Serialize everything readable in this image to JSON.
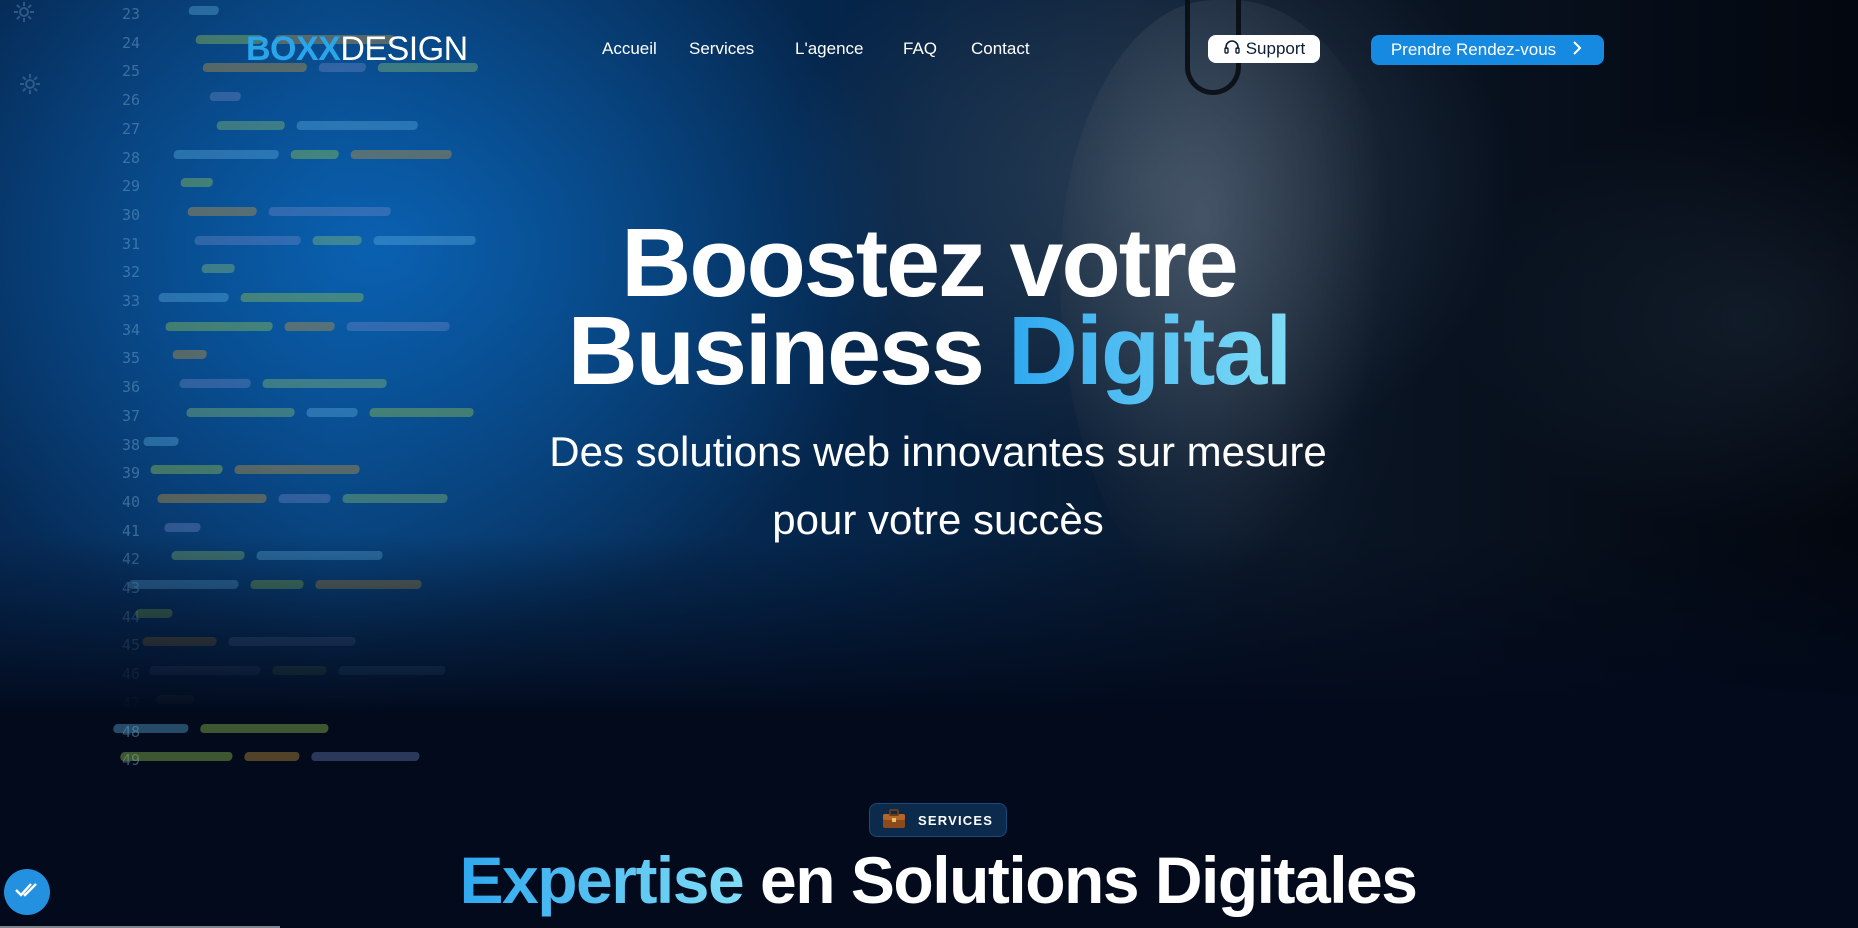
{
  "logo": {
    "prefix": "BO",
    "accent": "XX",
    "suffix": "DESIGN"
  },
  "nav": {
    "items": [
      "Accueil",
      "Services",
      "L'agence",
      "FAQ",
      "Contact"
    ]
  },
  "header": {
    "support_label": "Support",
    "cta_label": "Prendre Rendez-vous"
  },
  "hero": {
    "title_line1": "Boostez votre",
    "title_line2_plain": "Business",
    "title_line2_highlight": "Digital",
    "subtitle_line1": "Des solutions web innovantes sur mesure",
    "subtitle_line2": "pour votre succès"
  },
  "services": {
    "badge_label": "SERVICES",
    "title_highlight": "Expertise",
    "title_rest": "en Solutions Digitales"
  },
  "background": {
    "code_line_numbers": [
      "23",
      "24",
      "25",
      "26",
      "27",
      "28",
      "29",
      "30",
      "31",
      "32",
      "33",
      "34",
      "35",
      "36",
      "37",
      "38",
      "39",
      "40",
      "41",
      "42",
      "43",
      "44",
      "45",
      "46",
      "47",
      "48",
      "49"
    ]
  },
  "colors": {
    "accent": "#2aa5ea",
    "cta": "#1689e0",
    "page_bg": "#020a1c"
  },
  "icons": {
    "support": "headset-icon",
    "cta": "chevron-right-icon",
    "badge": "briefcase-icon",
    "fab": "double-check-icon",
    "sidebar": "gear-icon"
  }
}
